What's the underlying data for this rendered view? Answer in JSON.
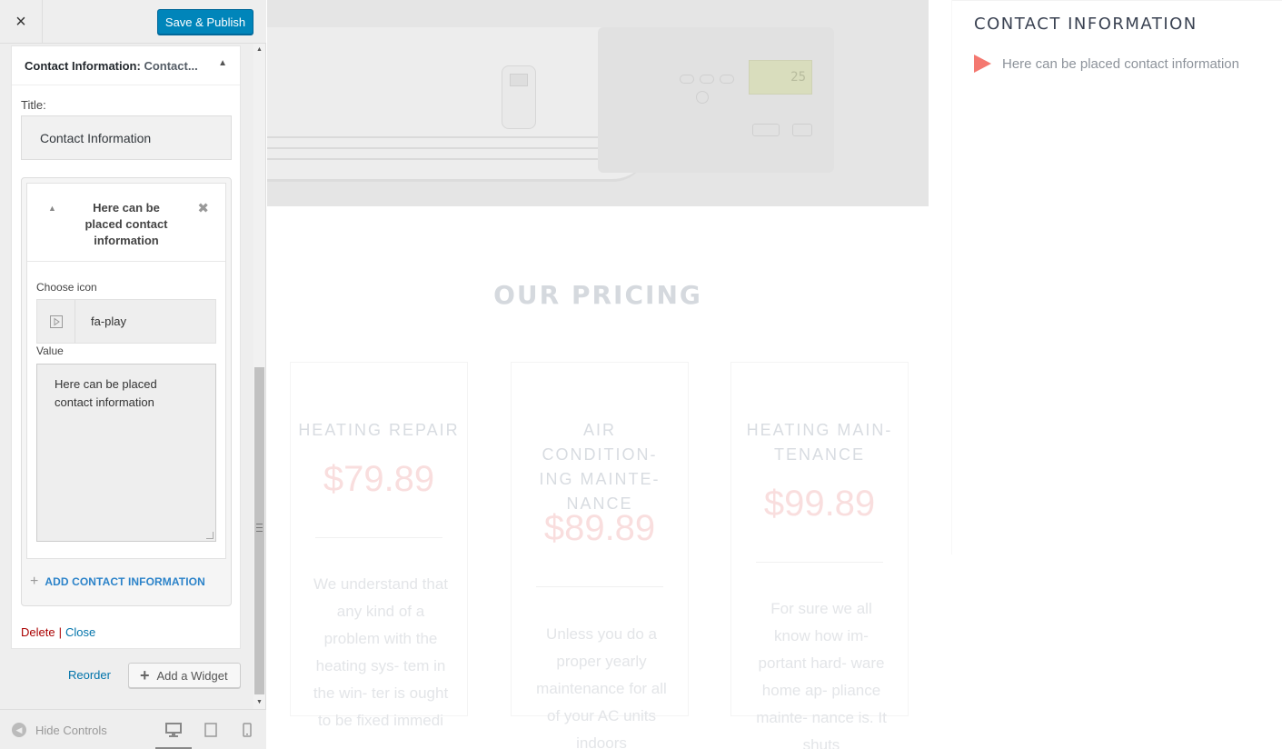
{
  "header": {
    "close_label": "×",
    "save_label": "Save & Publish"
  },
  "widget": {
    "title": "Contact Information:",
    "title_sub": "Contact...",
    "title_field_label": "Title:",
    "title_field_value": "Contact Information",
    "item": {
      "heading": "Here can be placed contact information",
      "choose_icon_label": "Choose icon",
      "icon_value": "fa-play",
      "value_label": "Value",
      "value_text": "Here can be placed contact information"
    },
    "add_contact_label": "ADD CONTACT INFORMATION",
    "delete_label": "Delete",
    "separator": "|",
    "close_label": "Close"
  },
  "sidebar_actions": {
    "reorder_label": "Reorder",
    "add_widget_label": "Add a Widget"
  },
  "footer": {
    "hide_controls_label": "Hide Controls",
    "devices": [
      "desktop-icon",
      "tablet-icon",
      "mobile-icon"
    ],
    "active_device": "desktop"
  },
  "preview": {
    "pricing_title": "OUR PRICING",
    "thermostat_display": "25",
    "cards": [
      {
        "name": "HEATING REPAIR",
        "price": "$79.89",
        "description": "We understand that any kind of a problem with the heating sys- tem in the win- ter is ought to be fixed immedi"
      },
      {
        "name": "AIR CONDITION- ING MAINTE- NANCE",
        "price": "$89.89",
        "description": "Unless you do a proper yearly maintenance for all of your AC units indoors"
      },
      {
        "name": "HEATING MAIN- TENANCE",
        "price": "$99.89",
        "description": "For sure we all know how im- portant hard- ware home ap- pliance mainte- nance is. It shuts"
      }
    ],
    "contact_widget": {
      "title": "CONTACT INFORMATION",
      "item_text": "Here can be placed contact information",
      "icon": "play-icon",
      "icon_color": "#f47870"
    }
  },
  "colors": {
    "primary_button": "#0085ba",
    "link": "#0073aa",
    "delete": "#aa0000",
    "accent": "#f47870"
  }
}
